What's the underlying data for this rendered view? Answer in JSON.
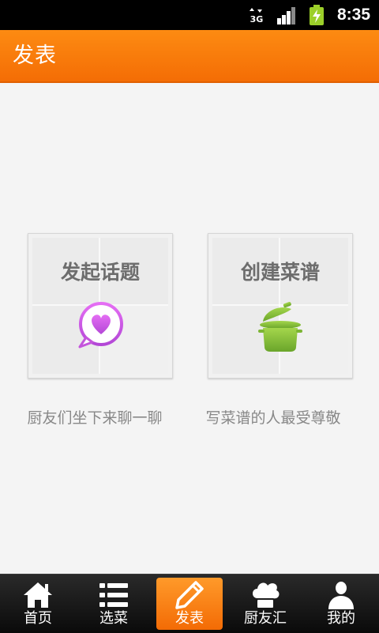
{
  "status_bar": {
    "network": "3G",
    "time": "8:35"
  },
  "header": {
    "title": "发表"
  },
  "cards": [
    {
      "title": "发起话题",
      "caption": "厨友们坐下来聊一聊",
      "icon": "chat-heart-icon",
      "icon_color": "#c455dc"
    },
    {
      "title": "创建菜谱",
      "caption": "写菜谱的人最受尊敬",
      "icon": "cooking-pot-icon",
      "icon_color": "#7cb534"
    }
  ],
  "bottom_nav": {
    "items": [
      {
        "label": "首页",
        "icon": "home-icon"
      },
      {
        "label": "选菜",
        "icon": "list-icon"
      },
      {
        "label": "发表",
        "icon": "pencil-icon",
        "active": true
      },
      {
        "label": "厨友汇",
        "icon": "chef-hat-icon"
      },
      {
        "label": "我的",
        "icon": "user-icon"
      }
    ]
  },
  "colors": {
    "accent": "#f57a0a",
    "status_bar": "#000000",
    "nav_bar": "#1a1a1a"
  }
}
